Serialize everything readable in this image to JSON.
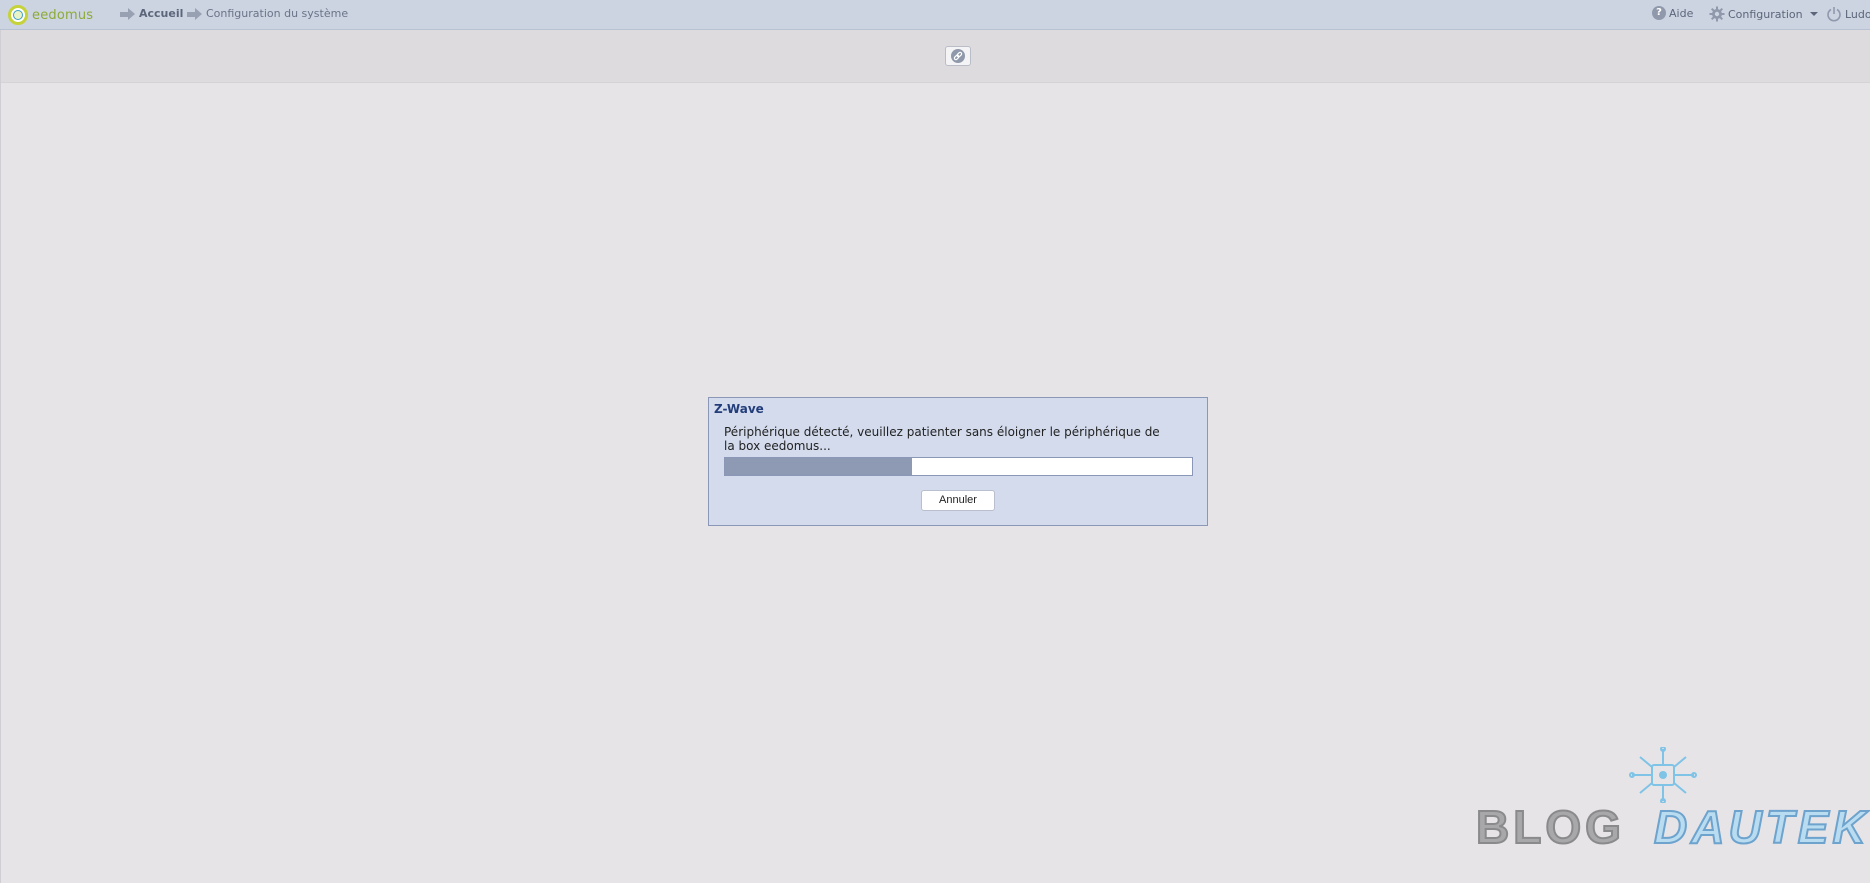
{
  "header": {
    "logo_text": "eedomus",
    "breadcrumb": [
      {
        "label": "Accueil"
      },
      {
        "label": "Configuration du système"
      }
    ],
    "help_label": "Aide",
    "help_icon": "question-icon",
    "config_label": "Configuration",
    "config_icon": "gear-icon",
    "user_label": "Ludov",
    "user_icon": "power-icon"
  },
  "toolbar": {
    "link_icon": "link-icon"
  },
  "dialog": {
    "title": "Z-Wave",
    "message": "Périphérique détecté, veuillez patienter sans éloigner le périphérique de la box eedomus...",
    "progress": 0.4,
    "cancel_label": "Annuler"
  },
  "watermark": {
    "word1": "BLOG",
    "word2": "DAUTEK"
  },
  "colors": {
    "topbar": "#ccd4e1",
    "background": "#e7e4e8",
    "dialog_bg": "#d3dbed",
    "dialog_title": "#233d7a",
    "progress_fill": "#8e9ab4"
  }
}
